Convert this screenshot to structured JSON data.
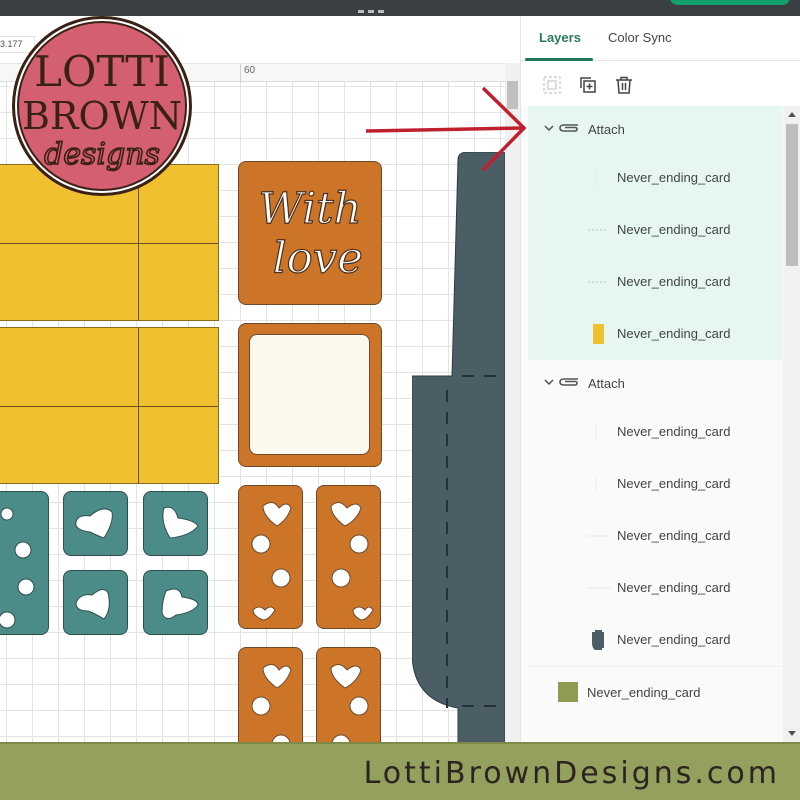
{
  "topbar": {
    "accent_color": "#12a06a"
  },
  "canvas": {
    "coordinate_readout": "3.177",
    "ruler_label": "60",
    "shape_colors": {
      "yellow": "#f0c030",
      "orange": "#cc7529",
      "teal": "#4b8c88",
      "dark_slate": "#4b5e66",
      "cream": "#fbf8ee"
    },
    "sentiment_panel_text_line1": "With",
    "sentiment_panel_text_line2": "love"
  },
  "logo": {
    "line1": "LOTTI",
    "line2": "BROWN",
    "line3": "designs",
    "fill_color": "#d45f70",
    "ink_color": "#3a2116"
  },
  "sidebar": {
    "tabs": [
      {
        "label": "Layers",
        "active": true
      },
      {
        "label": "Color Sync",
        "active": false
      }
    ],
    "toolbar": {
      "group_icon": "group-icon",
      "duplicate_icon": "duplicate-icon",
      "delete_icon": "trash-icon"
    },
    "groups": [
      {
        "label": "Attach",
        "expanded": true,
        "selected": true,
        "layers": [
          {
            "name": "Never_ending_card",
            "thumb": "blank"
          },
          {
            "name": "Never_ending_card",
            "thumb": "dotted-line"
          },
          {
            "name": "Never_ending_card",
            "thumb": "dotted-line"
          },
          {
            "name": "Never_ending_card",
            "thumb": "yellow-rect"
          }
        ]
      },
      {
        "label": "Attach",
        "expanded": true,
        "selected": false,
        "layers": [
          {
            "name": "Never_ending_card",
            "thumb": "blank"
          },
          {
            "name": "Never_ending_card",
            "thumb": "blank"
          },
          {
            "name": "Never_ending_card",
            "thumb": "thin-line"
          },
          {
            "name": "Never_ending_card",
            "thumb": "thin-line"
          },
          {
            "name": "Never_ending_card",
            "thumb": "slate-shape"
          }
        ]
      }
    ],
    "single_layers": [
      {
        "name": "Never_ending_card",
        "thumb": "green-card"
      }
    ]
  },
  "footer": {
    "website": "LottiBrownDesigns.com",
    "background_color": "#93a05e"
  }
}
